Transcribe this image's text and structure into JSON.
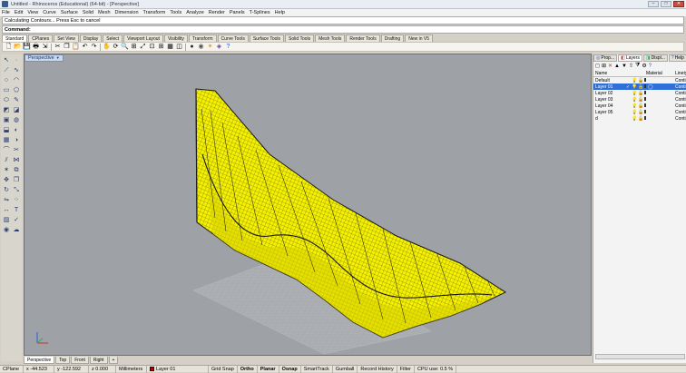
{
  "window": {
    "title": "Untitled - Rhinoceros (Educational) (64-bit) - [Perspective]",
    "buttons": [
      "–",
      "□",
      "✕"
    ]
  },
  "menu": [
    "File",
    "Edit",
    "View",
    "Curve",
    "Surface",
    "Solid",
    "Mesh",
    "Dimension",
    "Transform",
    "Tools",
    "Analyze",
    "Render",
    "Panels",
    "T-Splines",
    "Help"
  ],
  "command_history": "Calculating Contours... Press Esc to cancel",
  "command_prompt": "Command:",
  "toolbar_tabs": [
    "Standard",
    "CPlanes",
    "Set View",
    "Display",
    "Select",
    "Viewport Layout",
    "Visibility",
    "Transform",
    "Curve Tools",
    "Surface Tools",
    "Solid Tools",
    "Mesh Tools",
    "Render Tools",
    "Drafting",
    "New in V5"
  ],
  "active_toolbar_tab": "Standard",
  "toolbar_icons": [
    "new-file-icon",
    "open-file-icon",
    "save-icon",
    "print-icon",
    "import-icon",
    "cut-icon",
    "copy-icon",
    "paste-icon",
    "undo-icon",
    "redo-icon",
    "pan-icon",
    "rotate-view-icon",
    "zoom-icon",
    "zoom-window-icon",
    "zoom-extents-icon",
    "zoom-selected-icon",
    "four-views-icon",
    "grid-icon",
    "cplane-icon",
    "shade-icon",
    "render-icon",
    "lights-icon",
    "properties-icon",
    "help-icon"
  ],
  "viewport": {
    "name": "Perspective",
    "colors": {
      "background": "#9ea1a5",
      "surface": "#f4f000",
      "wire": "#1a1a1a",
      "grid": "#b7babd"
    }
  },
  "view_tabs": [
    "Perspective",
    "Top",
    "Front",
    "Right",
    "+"
  ],
  "active_view_tab": "Perspective",
  "panel": {
    "tabs": [
      "Prop...",
      "Layers",
      "Displ...",
      "Help"
    ],
    "active_tab": "Layers",
    "columns": {
      "name": "Name",
      "material": "Material",
      "linetype": "Linety"
    },
    "layers": [
      {
        "name": "Default",
        "color": "#000000",
        "linetype": "Contin",
        "active": false,
        "current": false
      },
      {
        "name": "Layer 01",
        "color": "#b80000",
        "linetype": "Contin",
        "active": true,
        "current": true
      },
      {
        "name": "Layer 02",
        "color": "#7a2aa8",
        "linetype": "Contin",
        "active": false,
        "current": false
      },
      {
        "name": "Layer 03",
        "color": "#2147c8",
        "linetype": "Contin",
        "active": false,
        "current": false
      },
      {
        "name": "Layer 04",
        "color": "#1fa13a",
        "linetype": "Contin",
        "active": false,
        "current": false
      },
      {
        "name": "Layer 05",
        "color": "#ffffff",
        "linetype": "Contin",
        "active": false,
        "current": false
      },
      {
        "name": "d",
        "color": "#000000",
        "linetype": "Contin",
        "active": false,
        "current": false
      }
    ]
  },
  "status": {
    "cplane": "CPlane",
    "x": "x -44.523",
    "y": "y -122.592",
    "z": "z 0.000",
    "units": "Millimeters",
    "layer": "Layer 01",
    "layer_color": "#b80000",
    "grid_snap": "Grid Snap",
    "ortho": "Ortho",
    "planar": "Planar",
    "osnap": "Osnap",
    "smarttrack": "SmartTrack",
    "gumball": "Gumball",
    "record_history": "Record History",
    "filter": "Filter",
    "cpu": "CPU use: 0.5 %"
  }
}
